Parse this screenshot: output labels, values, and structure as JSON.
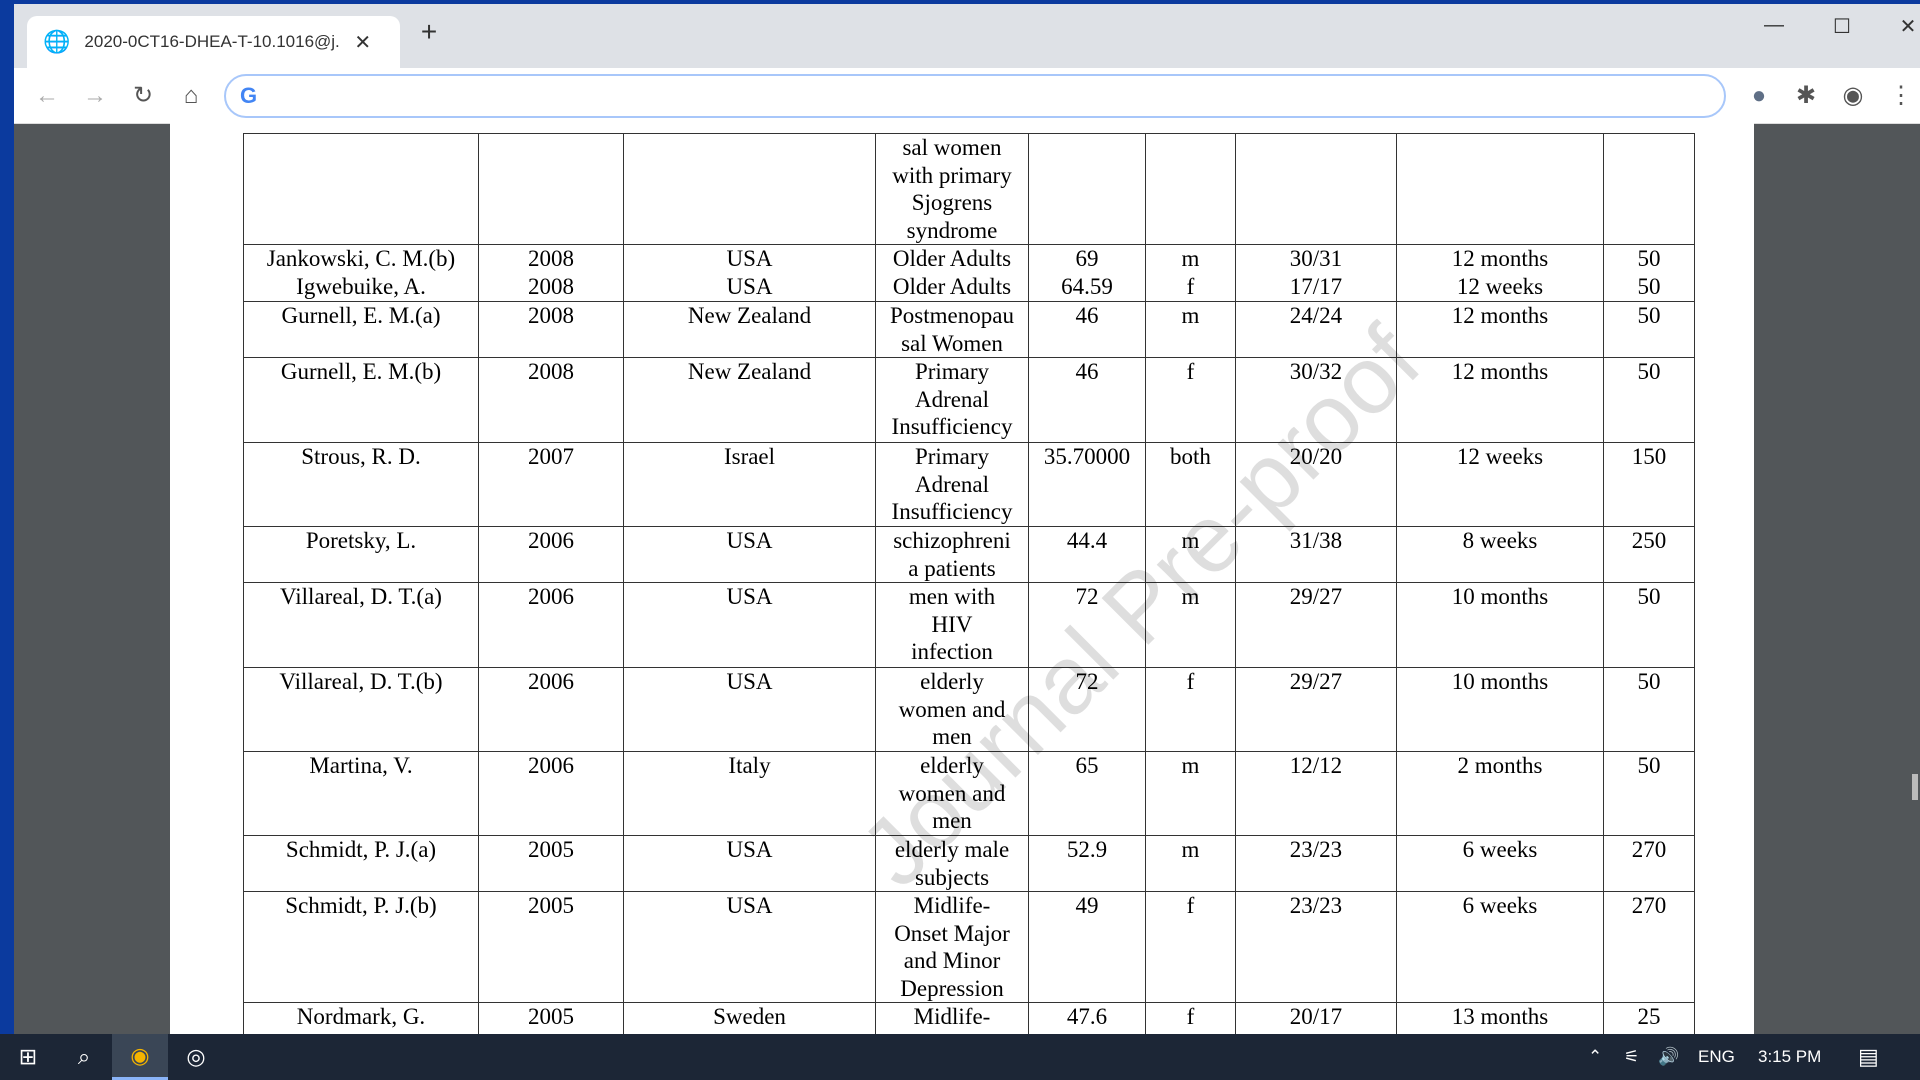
{
  "browser": {
    "tab_title": "2020-0CT16-DHEA-T-10.1016@j.",
    "new_tab": "+",
    "omnibox_value": ""
  },
  "watermark": "Journal Pre-proof",
  "table": {
    "rows": [
      [
        "",
        "",
        "",
        "sal women\nwith primary\nSjogrens\nsyndrome",
        "",
        "",
        "",
        "",
        ""
      ],
      [
        "Jankowski, C. M.(b)\nIgwebuike, A.",
        "2008\n2008",
        "USA\nUSA",
        "Older Adults\nOlder Adults",
        "69\n64.59",
        "m\nf",
        "30/31\n17/17",
        "12 months\n12 weeks",
        "50\n50"
      ],
      [
        "Gurnell, E. M.(a)",
        "2008",
        "New Zealand",
        "Postmenopau\nsal Women",
        "46",
        "m",
        "24/24",
        "12 months",
        "50"
      ],
      [
        "Gurnell, E. M.(b)",
        "2008",
        "New Zealand",
        "Primary\nAdrenal\nInsufficiency",
        "46",
        "f",
        "30/32",
        "12 months",
        "50"
      ],
      [
        "Strous, R. D.",
        "2007",
        "Israel",
        "Primary\nAdrenal\nInsufficiency",
        "35.70000",
        "both",
        "20/20",
        "12 weeks",
        "150"
      ],
      [
        "Poretsky, L.",
        "2006",
        "USA",
        "schizophreni\na patients",
        "44.4",
        "m",
        "31/38",
        "8 weeks",
        "250"
      ],
      [
        "Villareal, D. T.(a)",
        "2006",
        "USA",
        "men with\nHIV\ninfection",
        "72",
        "m",
        "29/27",
        "10 months",
        "50"
      ],
      [
        "Villareal, D. T.(b)",
        "2006",
        "USA",
        "elderly\nwomen and\nmen",
        "72",
        "f",
        "29/27",
        "10 months",
        "50"
      ],
      [
        "Martina, V.",
        "2006",
        "Italy",
        "elderly\nwomen and\nmen",
        "65",
        "m",
        "12/12",
        "2 months",
        "50"
      ],
      [
        "Schmidt, P. J.(a)",
        "2005",
        "USA",
        "elderly male\nsubjects",
        "52.9",
        "m",
        "23/23",
        "6 weeks",
        "270"
      ],
      [
        "Schmidt, P. J.(b)",
        "2005",
        "USA",
        "Midlife-\nOnset Major\nand Minor\nDepression",
        "49",
        "f",
        "23/23",
        "6 weeks",
        "270"
      ],
      [
        "Nordmark, G.",
        "2005",
        "Sweden",
        "Midlife-",
        "47.6",
        "f",
        "20/17",
        "13 months",
        "25"
      ]
    ]
  },
  "taskbar": {
    "language": "ENG",
    "time": "3:15 PM"
  }
}
